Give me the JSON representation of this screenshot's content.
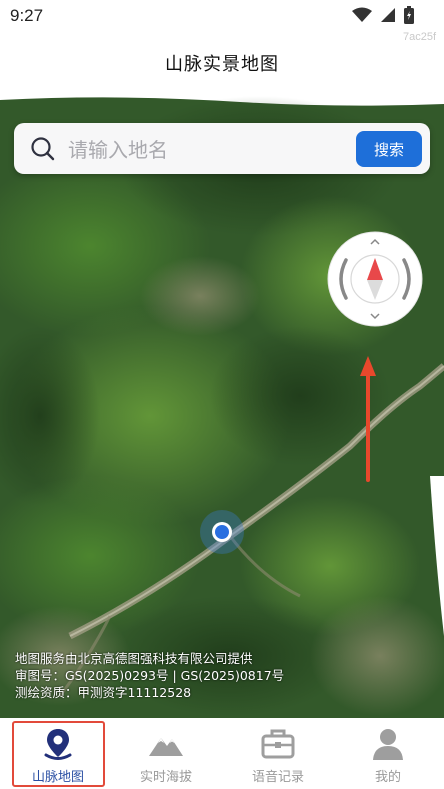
{
  "status_bar": {
    "time": "9:27",
    "icons": [
      "wifi-icon",
      "signal-icon",
      "battery-icon"
    ],
    "watermark": "7ac25f"
  },
  "header": {
    "title": "山脉实景地图"
  },
  "search": {
    "placeholder": "请输入地名",
    "button_label": "搜索"
  },
  "map": {
    "compass": "compass-icon",
    "attribution": [
      "地图服务由北京高德图强科技有限公司提供",
      "审图号：GS(2025)0293号 | GS(2025)0817号",
      "测绘资质：甲测资字11112528"
    ]
  },
  "tabs": [
    {
      "label": "山脉地图",
      "icon": "location-pin-icon",
      "active": true
    },
    {
      "label": "实时海拔",
      "icon": "mountain-icon",
      "active": false
    },
    {
      "label": "语音记录",
      "icon": "briefcase-icon",
      "active": false
    },
    {
      "label": "我的",
      "icon": "user-icon",
      "active": false
    }
  ],
  "colors": {
    "accent": "#1e6fd9",
    "active_tab": "#2a4fa3",
    "highlight_frame": "#e24a3a",
    "compass_north": "#e8484a",
    "direction_arrow": "#e8482c"
  }
}
